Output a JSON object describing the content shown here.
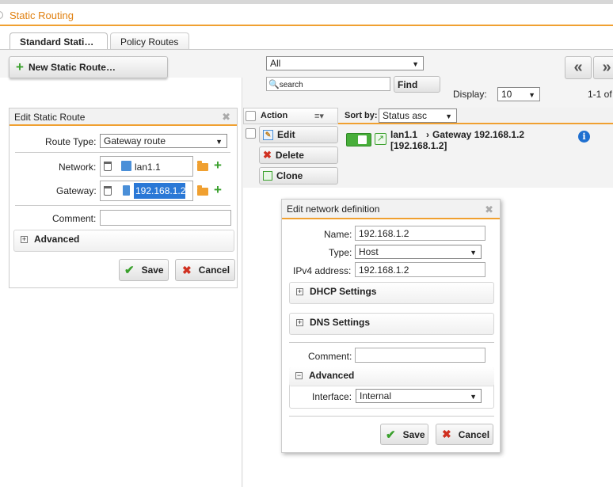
{
  "title": "Static Routing",
  "tabs": [
    {
      "label": "Standard Stati…"
    },
    {
      "label": "Policy Routes"
    }
  ],
  "toolbar": {
    "new_label": "New Static Route…",
    "filter_value": "All",
    "search_placeholder": "search",
    "find_label": "Find",
    "display_label": "Display:",
    "display_value": "10",
    "page_info": "1-1 of",
    "prev_label": "«",
    "next_label": "»"
  },
  "list": {
    "action_header": "Action",
    "sortby_label": "Sort by:",
    "sortby_value": "Status asc",
    "edit_label": "Edit",
    "delete_label": "Delete",
    "clone_label": "Clone",
    "row_name": "lan1.1",
    "row_arrow": "›",
    "row_target": "Gateway 192.168.1.2",
    "row_ip": "[192.168.1.2]",
    "info_glyph": "i"
  },
  "edit_route": {
    "title": "Edit Static Route",
    "route_type_label": "Route Type:",
    "route_type_value": "Gateway route",
    "network_label": "Network:",
    "network_value": "lan1.1",
    "gateway_label": "Gateway:",
    "gateway_value": "192.168.1.2",
    "comment_label": "Comment:",
    "comment_value": "",
    "advanced_label": "Advanced",
    "save_label": "Save",
    "cancel_label": "Cancel"
  },
  "net_def": {
    "title": "Edit network definition",
    "name_label": "Name:",
    "name_value": "192.168.1.2",
    "type_label": "Type:",
    "type_value": "Host",
    "ipv4_label": "IPv4 address:",
    "ipv4_value": "192.168.1.2",
    "dhcp_label": "DHCP Settings",
    "dns_label": "DNS Settings",
    "comment_label": "Comment:",
    "comment_value": "",
    "advanced_label": "Advanced",
    "interface_label": "Interface:",
    "interface_value": "Internal",
    "save_label": "Save",
    "cancel_label": "Cancel"
  },
  "glyphs": {
    "check": "✔",
    "cross": "✖",
    "close": "✖",
    "plus": "+",
    "minus": "−",
    "caret": "▼",
    "search": "🔍"
  }
}
